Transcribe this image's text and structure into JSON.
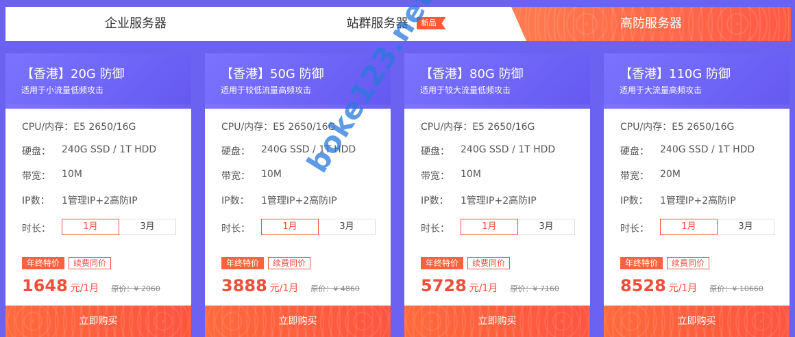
{
  "tabs": [
    {
      "label": "企业服务器"
    },
    {
      "label": "站群服务器",
      "badge": "新品"
    },
    {
      "label": "高防服务器",
      "active": true
    }
  ],
  "spec_labels": {
    "cpu": "CPU/内存：",
    "disk": "硬盘：",
    "bandwidth": "带宽：",
    "ip": "IP数：",
    "duration": "时长："
  },
  "cards": [
    {
      "title": "【香港】20G 防御",
      "subtitle": "适用于小流量低频攻击",
      "cpu": "E5 2650/16G",
      "disk": "240G SSD / 1T HDD",
      "bandwidth": "10M",
      "ip": "1管理IP+2高防IP",
      "durations": [
        "1月",
        "3月"
      ],
      "tag_hot": "年终特价",
      "tag_same": "续费同价",
      "price": "1648",
      "unit": "元/1月",
      "original": "原价：¥ 2060",
      "buy": "立即购买"
    },
    {
      "title": "【香港】50G 防御",
      "subtitle": "适用于较低流量高频攻击",
      "cpu": "E5 2650/16G",
      "disk": "240G SSD / 1T HDD",
      "bandwidth": "10M",
      "ip": "1管理IP+2高防IP",
      "durations": [
        "1月",
        "3月"
      ],
      "tag_hot": "年终特价",
      "tag_same": "续费同价",
      "price": "3888",
      "unit": "元/1月",
      "original": "原价：¥ 4860",
      "buy": "立即购买"
    },
    {
      "title": "【香港】80G 防御",
      "subtitle": "适用于较大流量低频攻击",
      "cpu": "E5 2650/16G",
      "disk": "240G SSD / 1T HDD",
      "bandwidth": "10M",
      "ip": "1管理IP+2高防IP",
      "durations": [
        "1月",
        "3月"
      ],
      "tag_hot": "年终特价",
      "tag_same": "续费同价",
      "price": "5728",
      "unit": "元/1月",
      "original": "原价：¥ 7160",
      "buy": "立即购买"
    },
    {
      "title": "【香港】110G 防御",
      "subtitle": "适用于大流量高频攻击",
      "cpu": "E5 2650/16G",
      "disk": "240G SSD / 1T HDD",
      "bandwidth": "20M",
      "ip": "1管理IP+2高防IP",
      "durations": [
        "1月",
        "3月"
      ],
      "tag_hot": "年终特价",
      "tag_same": "续费同价",
      "price": "8528",
      "unit": "元/1月",
      "original": "原价：¥ 10660",
      "buy": "立即购买"
    }
  ],
  "watermark": "boke123.net",
  "colors": {
    "background": "#6b62f2",
    "accent": "#f04d3a",
    "header": "#7068f8"
  }
}
